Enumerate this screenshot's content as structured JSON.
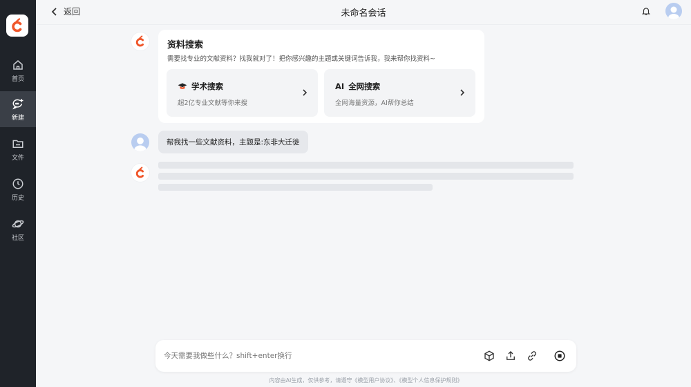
{
  "header": {
    "back_label": "返回",
    "title": "未命名会话"
  },
  "sidebar": {
    "items": [
      {
        "label": "首页",
        "icon": "home-icon"
      },
      {
        "label": "新建",
        "icon": "new-chat-icon",
        "active": true
      },
      {
        "label": "文件",
        "icon": "folder-icon"
      },
      {
        "label": "历史",
        "icon": "clock-icon"
      },
      {
        "label": "社区",
        "icon": "planet-icon"
      }
    ]
  },
  "card": {
    "title": "资料搜索",
    "description": "需要找专业的文献资料？找我就对了！把你感兴趣的主题或关键词告诉我，我来帮你找资料~",
    "options": [
      {
        "label": "学术搜索",
        "subtitle": "超2亿专业文献等你来搜",
        "icon": "graduation-cap-icon"
      },
      {
        "label": "全网搜索",
        "subtitle": "全网海量资源，AI帮你总结",
        "icon": "ai-icon"
      }
    ]
  },
  "messages": {
    "user_text": "帮我找一些文献资料，主题是:东非大迁徙"
  },
  "composer": {
    "placeholder": "今天需要我做些什么？shift+enter换行"
  },
  "footer": {
    "note": "内容由AI生成，仅供参考，请遵守《模型用户协议》、《模型个人信息保护规则》"
  },
  "colors": {
    "brand_orange": "#f0562a",
    "sidebar_bg": "#1f2329",
    "page_bg": "#f5f6f8"
  }
}
